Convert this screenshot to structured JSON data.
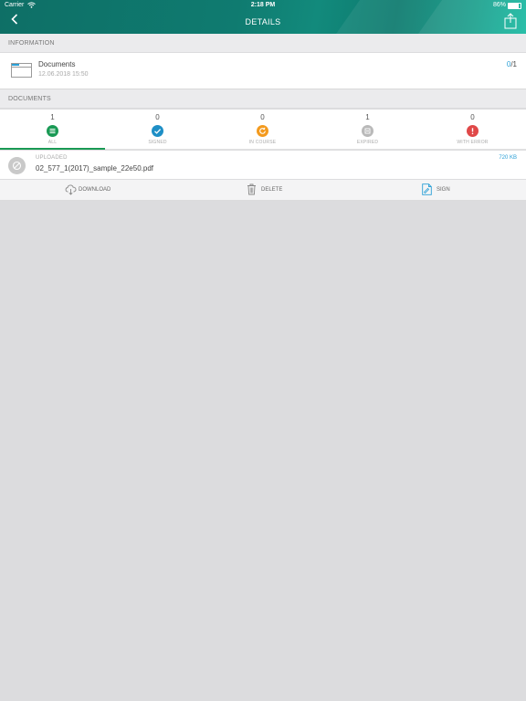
{
  "status_bar": {
    "carrier": "Carrier",
    "time": "2:18 PM",
    "battery": "86%"
  },
  "nav": {
    "title": "DETAILS",
    "back_icon": "chevron-left-icon",
    "share_icon": "share-icon"
  },
  "information": {
    "header": "INFORMATION",
    "name": "Documents",
    "date": "12.06.2018 15:50",
    "count_done": "0",
    "count_sep": "/",
    "count_total": "1"
  },
  "documents": {
    "header": "DOCUMENTS",
    "tabs": [
      {
        "label": "ALL",
        "count": "1",
        "icon": "list-icon",
        "color": "#1a9a55"
      },
      {
        "label": "SIGNED",
        "count": "0",
        "icon": "check-icon",
        "color": "#1e8fc6"
      },
      {
        "label": "IN COURSE",
        "count": "0",
        "icon": "refresh-icon",
        "color": "#f39a1e"
      },
      {
        "label": "EXPIRED",
        "count": "1",
        "icon": "expired-icon",
        "color": "#b9b9b9"
      },
      {
        "label": "WITH ERROR",
        "count": "0",
        "icon": "error-icon",
        "color": "#e04848"
      }
    ],
    "items": [
      {
        "status": "UPLOADED",
        "name": "02_577_1(2017)_sample_22e50.pdf",
        "size": "720 KB"
      }
    ],
    "actions": {
      "download": "DOWNLOAD",
      "delete": "DELETE",
      "sign": "SIGN"
    }
  }
}
